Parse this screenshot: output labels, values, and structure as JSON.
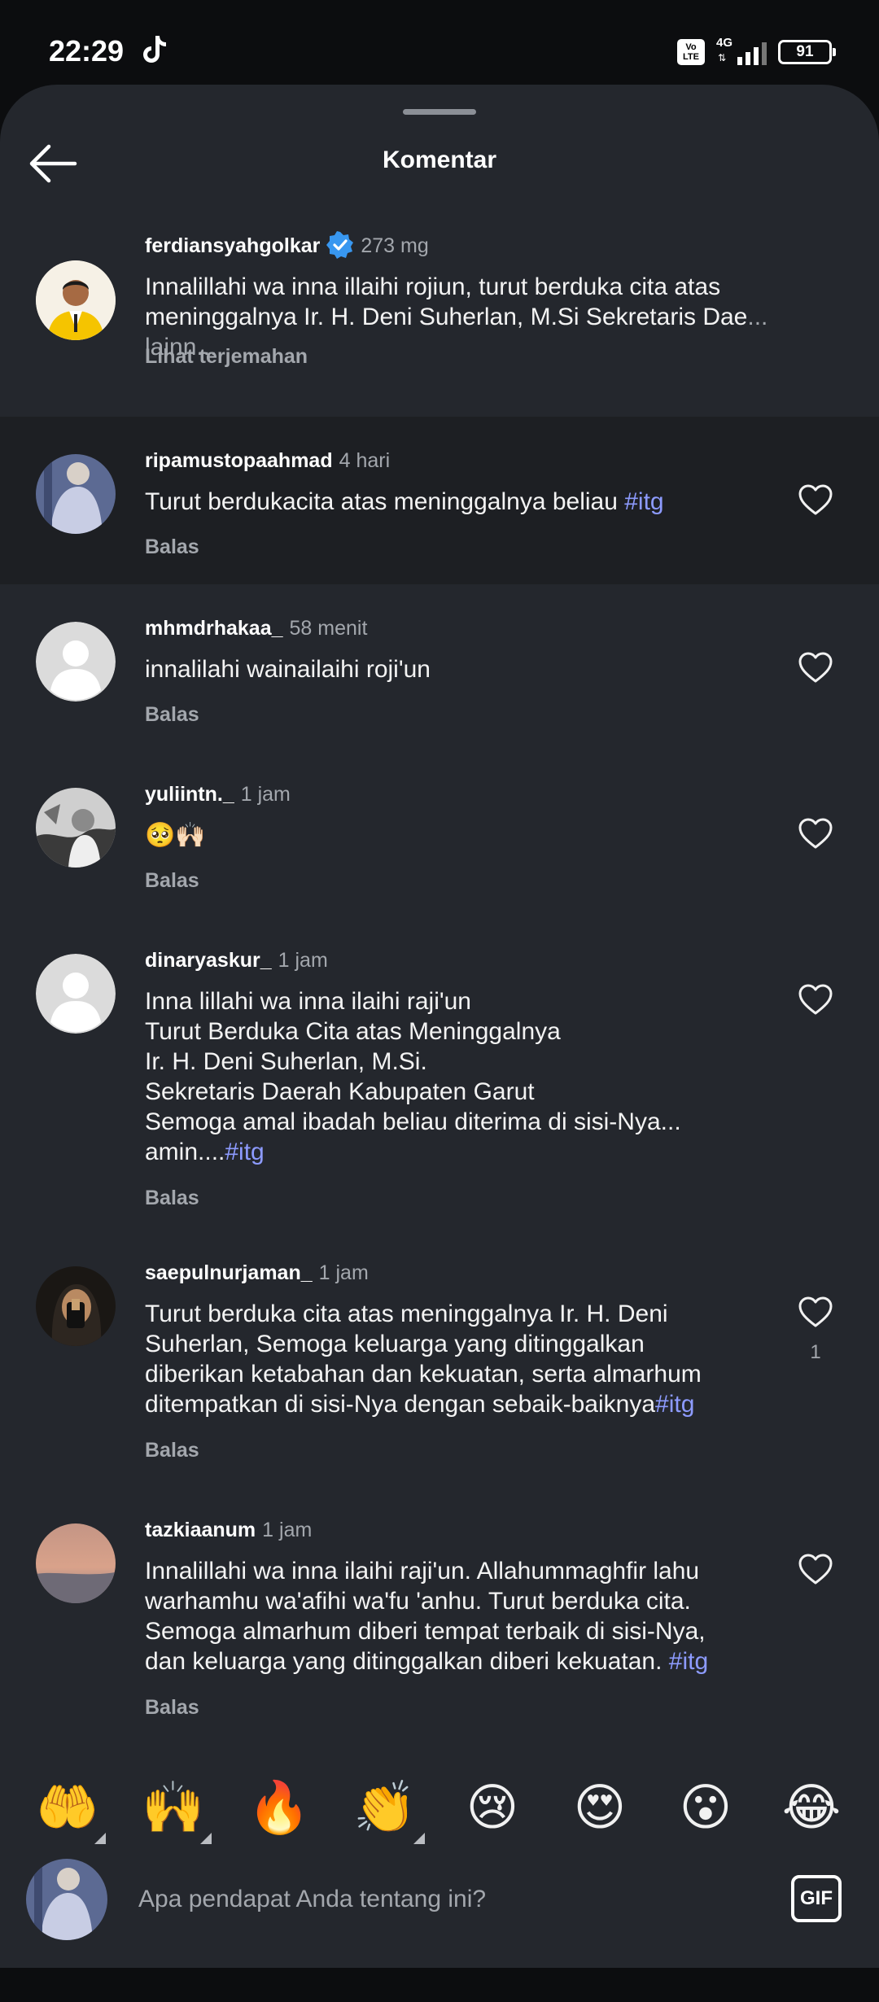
{
  "status_bar": {
    "time": "22:29",
    "network": "4G",
    "volte": "Vo\nLTE",
    "battery": "91"
  },
  "header": {
    "title": "Komentar"
  },
  "comments": [
    {
      "username": "ferdiansyahgolkar",
      "time": "273 mg",
      "verified": true,
      "text": "Innalillahi wa inna illaihi rojiun, turut berduka cita atas\nmeninggalnya Ir. H. Deni Suherlan, M.Si Sekretaris Dae",
      "more": "... lainn...",
      "action": "Lihat terjemahan"
    },
    {
      "username": "ripamustopaahmad",
      "time": "4 hari",
      "text": "Turut berdukacita atas meninggalnya beliau ",
      "tag": "#itg",
      "action": "Balas"
    },
    {
      "username": "mhmdrhakaa_",
      "time": "58 menit",
      "text": "innalilahi wainailaihi roji'un",
      "action": "Balas"
    },
    {
      "username": "yuliintn._",
      "time": "1 jam",
      "text": "🥺🙌🏻",
      "action": "Balas"
    },
    {
      "username": "dinaryaskur_",
      "time": "1 jam",
      "text": "Inna lillahi wa inna ilaihi raji'un\nTurut Berduka Cita atas Meninggalnya\nIr. H. Deni Suherlan, M.Si.\nSekretaris Daerah Kabupaten Garut\nSemoga amal ibadah beliau diterima di sisi-Nya...\namin....",
      "tag": "#itg",
      "action": "Balas"
    },
    {
      "username": "saepulnurjaman_",
      "time": "1 jam",
      "text": "Turut berduka cita atas meninggalnya Ir. H. Deni\nSuherlan, Semoga keluarga yang ditinggalkan\ndiberikan ketabahan dan kekuatan, serta almarhum\nditempatkan di sisi-Nya dengan sebaik-baiknya",
      "tag": "#itg",
      "likes": "1",
      "action": "Balas"
    },
    {
      "username": "tazkiaanum",
      "time": "1 jam",
      "text": "Innalillahi wa inna ilaihi raji'un. Allahummaghfir lahu\nwarhamhu wa'afihi wa'fu 'anhu. Turut berduka cita.\nSemoga almarhum diberi tempat terbaik di sisi-Nya,\ndan keluarga yang ditinggalkan diberi kekuatan. ",
      "tag": "#itg",
      "action": "Balas"
    }
  ],
  "quick_emojis": [
    "🤲",
    "🙌",
    "🔥",
    "👏",
    "😢",
    "😍",
    "😮",
    "😂"
  ],
  "composer": {
    "placeholder": "Apa pendapat Anda tentang ini?",
    "gif_label": "GIF"
  }
}
